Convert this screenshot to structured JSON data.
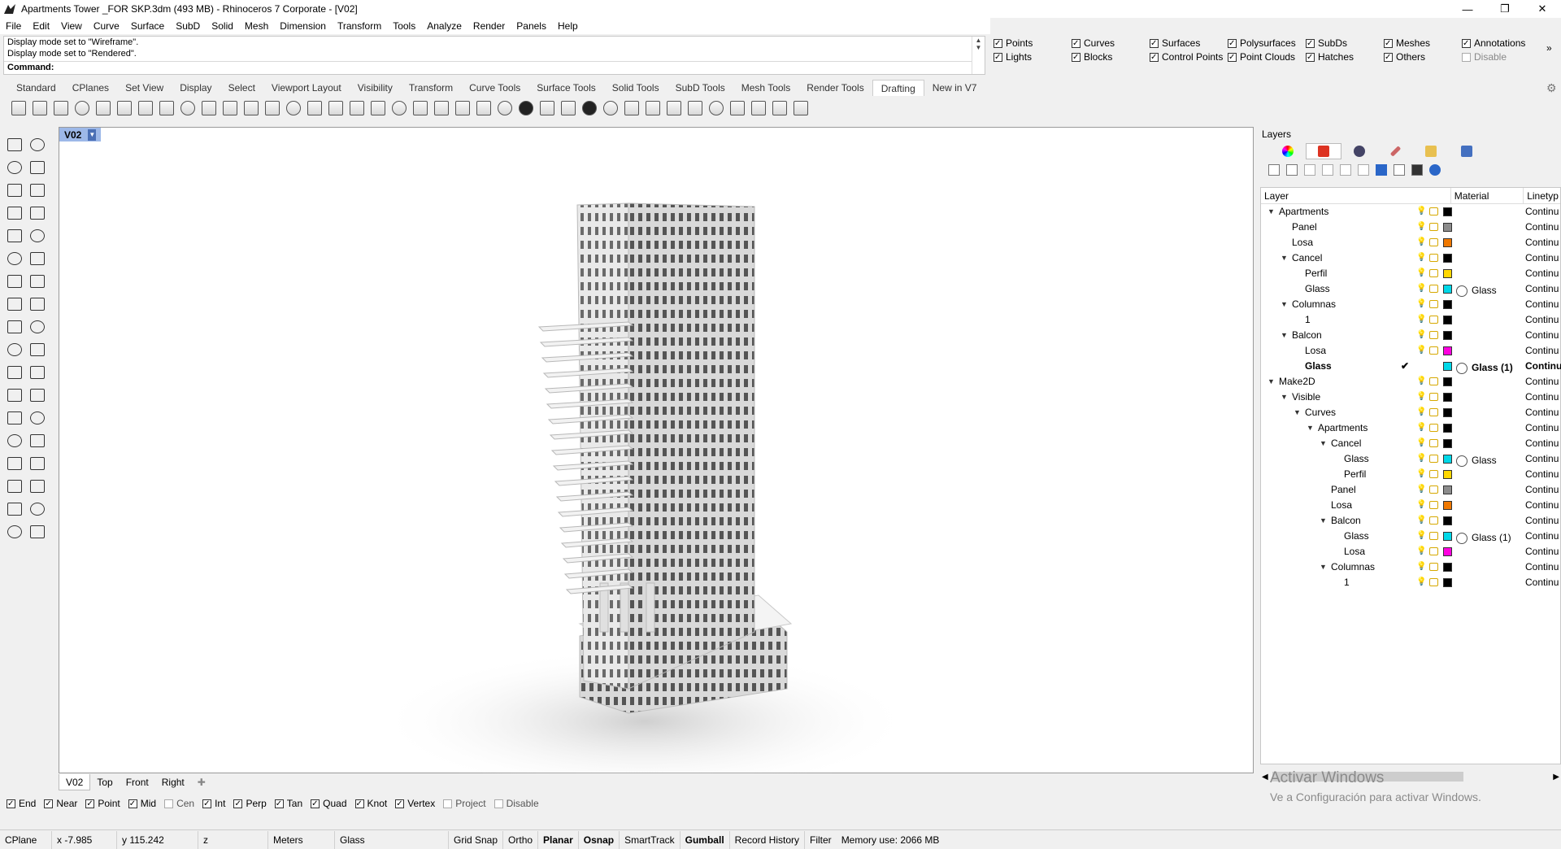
{
  "window": {
    "title": "Apartments Tower _FOR SKP.3dm (493 MB) - Rhinoceros 7 Corporate - [V02]",
    "minimize": "—",
    "maximize": "❐",
    "close": "✕"
  },
  "menu": [
    "File",
    "Edit",
    "View",
    "Curve",
    "Surface",
    "SubD",
    "Solid",
    "Mesh",
    "Dimension",
    "Transform",
    "Tools",
    "Analyze",
    "Render",
    "Panels",
    "Help"
  ],
  "command": {
    "history": [
      "Display mode set to \"Wireframe\".",
      "Display mode set to \"Rendered\"."
    ],
    "prompt_label": "Command:",
    "prompt_value": ""
  },
  "filters": [
    {
      "label": "Points",
      "checked": true
    },
    {
      "label": "Curves",
      "checked": true
    },
    {
      "label": "Surfaces",
      "checked": true
    },
    {
      "label": "Polysurfaces",
      "checked": true
    },
    {
      "label": "SubDs",
      "checked": true
    },
    {
      "label": "Meshes",
      "checked": true
    },
    {
      "label": "Annotations",
      "checked": true
    },
    {
      "label": "Lights",
      "checked": true
    },
    {
      "label": "Blocks",
      "checked": true
    },
    {
      "label": "Control Points",
      "checked": true
    },
    {
      "label": "Point Clouds",
      "checked": true
    },
    {
      "label": "Hatches",
      "checked": true
    },
    {
      "label": "Others",
      "checked": true
    },
    {
      "label": "Disable",
      "checked": false
    }
  ],
  "filters_more": "»",
  "toolbar_tabs": [
    "Standard",
    "CPlanes",
    "Set View",
    "Display",
    "Select",
    "Viewport Layout",
    "Visibility",
    "Transform",
    "Curve Tools",
    "Surface Tools",
    "Solid Tools",
    "SubD Tools",
    "Mesh Tools",
    "Render Tools",
    "Drafting",
    "New in V7"
  ],
  "active_toolbar_tab": "Drafting",
  "viewport": {
    "label": "V02",
    "tabs": [
      "V02",
      "Top",
      "Front",
      "Right"
    ],
    "add_tab": "✚"
  },
  "osnaps": [
    {
      "label": "End",
      "checked": true
    },
    {
      "label": "Near",
      "checked": true
    },
    {
      "label": "Point",
      "checked": true
    },
    {
      "label": "Mid",
      "checked": true
    },
    {
      "label": "Cen",
      "checked": false
    },
    {
      "label": "Int",
      "checked": true
    },
    {
      "label": "Perp",
      "checked": true
    },
    {
      "label": "Tan",
      "checked": true
    },
    {
      "label": "Quad",
      "checked": true
    },
    {
      "label": "Knot",
      "checked": true
    },
    {
      "label": "Vertex",
      "checked": true
    },
    {
      "label": "Project",
      "checked": false
    },
    {
      "label": "Disable",
      "checked": false
    }
  ],
  "status": {
    "cplane": "CPlane",
    "x": "x -7.985",
    "y": "y 115.242",
    "z": "z",
    "units": "Meters",
    "layer": "Glass",
    "grid_snap": "Grid Snap",
    "ortho": "Ortho",
    "planar": "Planar",
    "osnap": "Osnap",
    "smarttrack": "SmartTrack",
    "gumball": "Gumball",
    "record_history": "Record History",
    "filter": "Filter",
    "memory": "Memory use: 2066 MB"
  },
  "layers": {
    "panel_title": "Layers",
    "col_layer": "Layer",
    "col_material": "Material",
    "col_linetype": "Linetyp",
    "rows": [
      {
        "name": "Apartments",
        "depth": 0,
        "expanded": true,
        "color": "#000000",
        "material": "",
        "linetype": "Continu",
        "current": false
      },
      {
        "name": "Panel",
        "depth": 1,
        "expanded": null,
        "color": "#8c8c8c",
        "material": "",
        "linetype": "Continu",
        "current": false
      },
      {
        "name": "Losa",
        "depth": 1,
        "expanded": null,
        "color": "#f07800",
        "material": "",
        "linetype": "Continu",
        "current": false
      },
      {
        "name": "Cancel",
        "depth": 1,
        "expanded": true,
        "color": "#000000",
        "material": "",
        "linetype": "Continu",
        "current": false
      },
      {
        "name": "Perfil",
        "depth": 2,
        "expanded": null,
        "color": "#ffd800",
        "material": "",
        "linetype": "Continu",
        "current": false
      },
      {
        "name": "Glass",
        "depth": 2,
        "expanded": null,
        "color": "#00d8e8",
        "material": "Glass",
        "linetype": "Continu",
        "current": false
      },
      {
        "name": "Columnas",
        "depth": 1,
        "expanded": true,
        "color": "#000000",
        "material": "",
        "linetype": "Continu",
        "current": false
      },
      {
        "name": "1",
        "depth": 2,
        "expanded": null,
        "color": "#000000",
        "material": "",
        "linetype": "Continu",
        "current": false
      },
      {
        "name": "Balcon",
        "depth": 1,
        "expanded": true,
        "color": "#000000",
        "material": "",
        "linetype": "Continu",
        "current": false
      },
      {
        "name": "Losa",
        "depth": 2,
        "expanded": null,
        "color": "#ff00e0",
        "material": "",
        "linetype": "Continu",
        "current": false
      },
      {
        "name": "Glass",
        "depth": 2,
        "expanded": null,
        "color": "#00d8e8",
        "material": "Glass (1)",
        "linetype": "Continu",
        "current": true
      },
      {
        "name": "Make2D",
        "depth": 0,
        "expanded": true,
        "color": "#000000",
        "material": "",
        "linetype": "Continu",
        "current": false
      },
      {
        "name": "Visible",
        "depth": 1,
        "expanded": true,
        "color": "#000000",
        "material": "",
        "linetype": "Continu",
        "current": false
      },
      {
        "name": "Curves",
        "depth": 2,
        "expanded": true,
        "color": "#000000",
        "material": "",
        "linetype": "Continu",
        "current": false
      },
      {
        "name": "Apartments",
        "depth": 3,
        "expanded": true,
        "color": "#000000",
        "material": "",
        "linetype": "Continu",
        "current": false
      },
      {
        "name": "Cancel",
        "depth": 4,
        "expanded": true,
        "color": "#000000",
        "material": "",
        "linetype": "Continu",
        "current": false
      },
      {
        "name": "Glass",
        "depth": 5,
        "expanded": null,
        "color": "#00d8e8",
        "material": "Glass",
        "linetype": "Continu",
        "current": false
      },
      {
        "name": "Perfil",
        "depth": 5,
        "expanded": null,
        "color": "#ffd800",
        "material": "",
        "linetype": "Continu",
        "current": false
      },
      {
        "name": "Panel",
        "depth": 4,
        "expanded": null,
        "color": "#8c8c8c",
        "material": "",
        "linetype": "Continu",
        "current": false
      },
      {
        "name": "Losa",
        "depth": 4,
        "expanded": null,
        "color": "#f07800",
        "material": "",
        "linetype": "Continu",
        "current": false
      },
      {
        "name": "Balcon",
        "depth": 4,
        "expanded": true,
        "color": "#000000",
        "material": "",
        "linetype": "Continu",
        "current": false
      },
      {
        "name": "Glass",
        "depth": 5,
        "expanded": null,
        "color": "#00d8e8",
        "material": "Glass (1)",
        "linetype": "Continu",
        "current": false
      },
      {
        "name": "Losa",
        "depth": 5,
        "expanded": null,
        "color": "#ff00e0",
        "material": "",
        "linetype": "Continu",
        "current": false
      },
      {
        "name": "Columnas",
        "depth": 4,
        "expanded": true,
        "color": "#000000",
        "material": "",
        "linetype": "Continu",
        "current": false
      },
      {
        "name": "1",
        "depth": 5,
        "expanded": null,
        "color": "#000000",
        "material": "",
        "linetype": "Continu",
        "current": false
      }
    ]
  },
  "watermark": {
    "line1": "Activar Windows",
    "line2": "Ve a Configuración para activar Windows."
  }
}
